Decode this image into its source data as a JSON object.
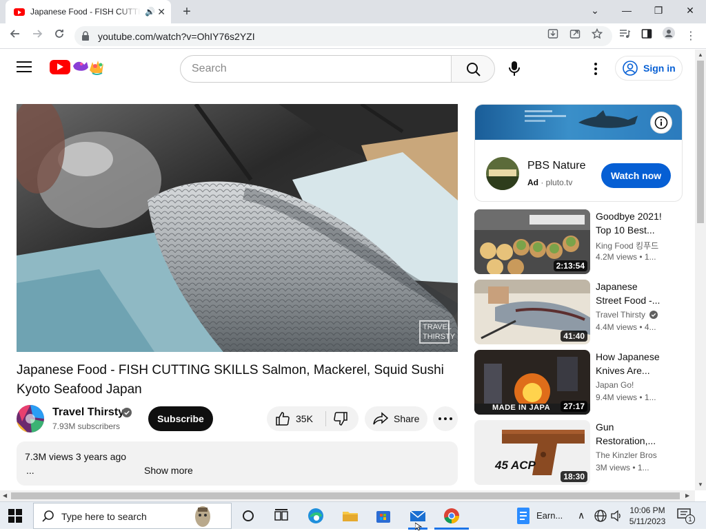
{
  "browser": {
    "tab_title": "Japanese Food - FISH CUTTING SKILLS",
    "url": "youtube.com/watch?v=OhIY76s2YZI"
  },
  "masthead": {
    "search_placeholder": "Search",
    "sign_in_label": "Sign in"
  },
  "video": {
    "title": "Japanese Food - FISH CUTTING SKILLS Salmon, Mackerel, Squid Sushi Kyoto Seafood Japan",
    "watermark_line1": "TRAVEL",
    "watermark_line2": "THIRSTY",
    "channel_name": "Travel Thirsty",
    "subscribers": "7.93M subscribers",
    "subscribe_label": "Subscribe",
    "likes": "35K",
    "share_label": "Share",
    "description": {
      "views_and_age": "7.3M views  3 years ago",
      "ellipsis": "...",
      "show_more": "Show more"
    }
  },
  "ad": {
    "title": "PBS Nature",
    "badge": "Ad",
    "domain": "· pluto.tv",
    "cta": "Watch now"
  },
  "recommendations": [
    {
      "title_line1": "Goodbye 2021!",
      "title_line2": "Top 10 Best...",
      "channel": "King Food 킹푸드",
      "stats": "4.2M views  • 1...",
      "duration": "2:13:54"
    },
    {
      "title_line1": "Japanese",
      "title_line2": "Street Food -...",
      "channel": "Travel Thirsty",
      "stats": "4.4M views  • 4...",
      "duration": "41:40"
    },
    {
      "title_line1": "How Japanese",
      "title_line2": "Knives Are...",
      "channel": "Japan Go!",
      "stats": "9.4M views  • 1...",
      "duration": "27:17",
      "thumb_caption": "MADE IN JAPA"
    },
    {
      "title_line1": "Gun",
      "title_line2": "Restoration,...",
      "channel": "The Kinzler Bros",
      "stats": "3M views  • 1...",
      "duration": "18:30",
      "thumb_caption": "45 ACP"
    }
  ],
  "taskbar": {
    "search_placeholder": "Type here to search",
    "earn_label": "Earn...",
    "time": "10:06 PM",
    "date": "5/11/2023",
    "notification_count": "1"
  },
  "colors": {
    "youtube_red": "#ff0000",
    "link_blue": "#065fd4",
    "subscribe_black": "#0f0f0f"
  }
}
